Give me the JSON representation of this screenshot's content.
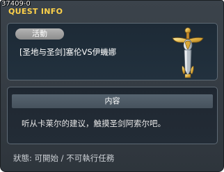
{
  "window": {
    "id": "37409-0",
    "title": "QUEST INFO",
    "title_color": "#ffd24a"
  },
  "quest": {
    "category_label": "活動",
    "name": "[圣地与圣剑]塞伦VS伊蟣娜",
    "emblem_icon": "sword-emblem-icon"
  },
  "content": {
    "header": "内容",
    "description": "听从卡莱尔的建议，触摸圣剑阿索尔吧。"
  },
  "status": {
    "text": "狀態: 可開始 / 不可執行任務"
  }
}
